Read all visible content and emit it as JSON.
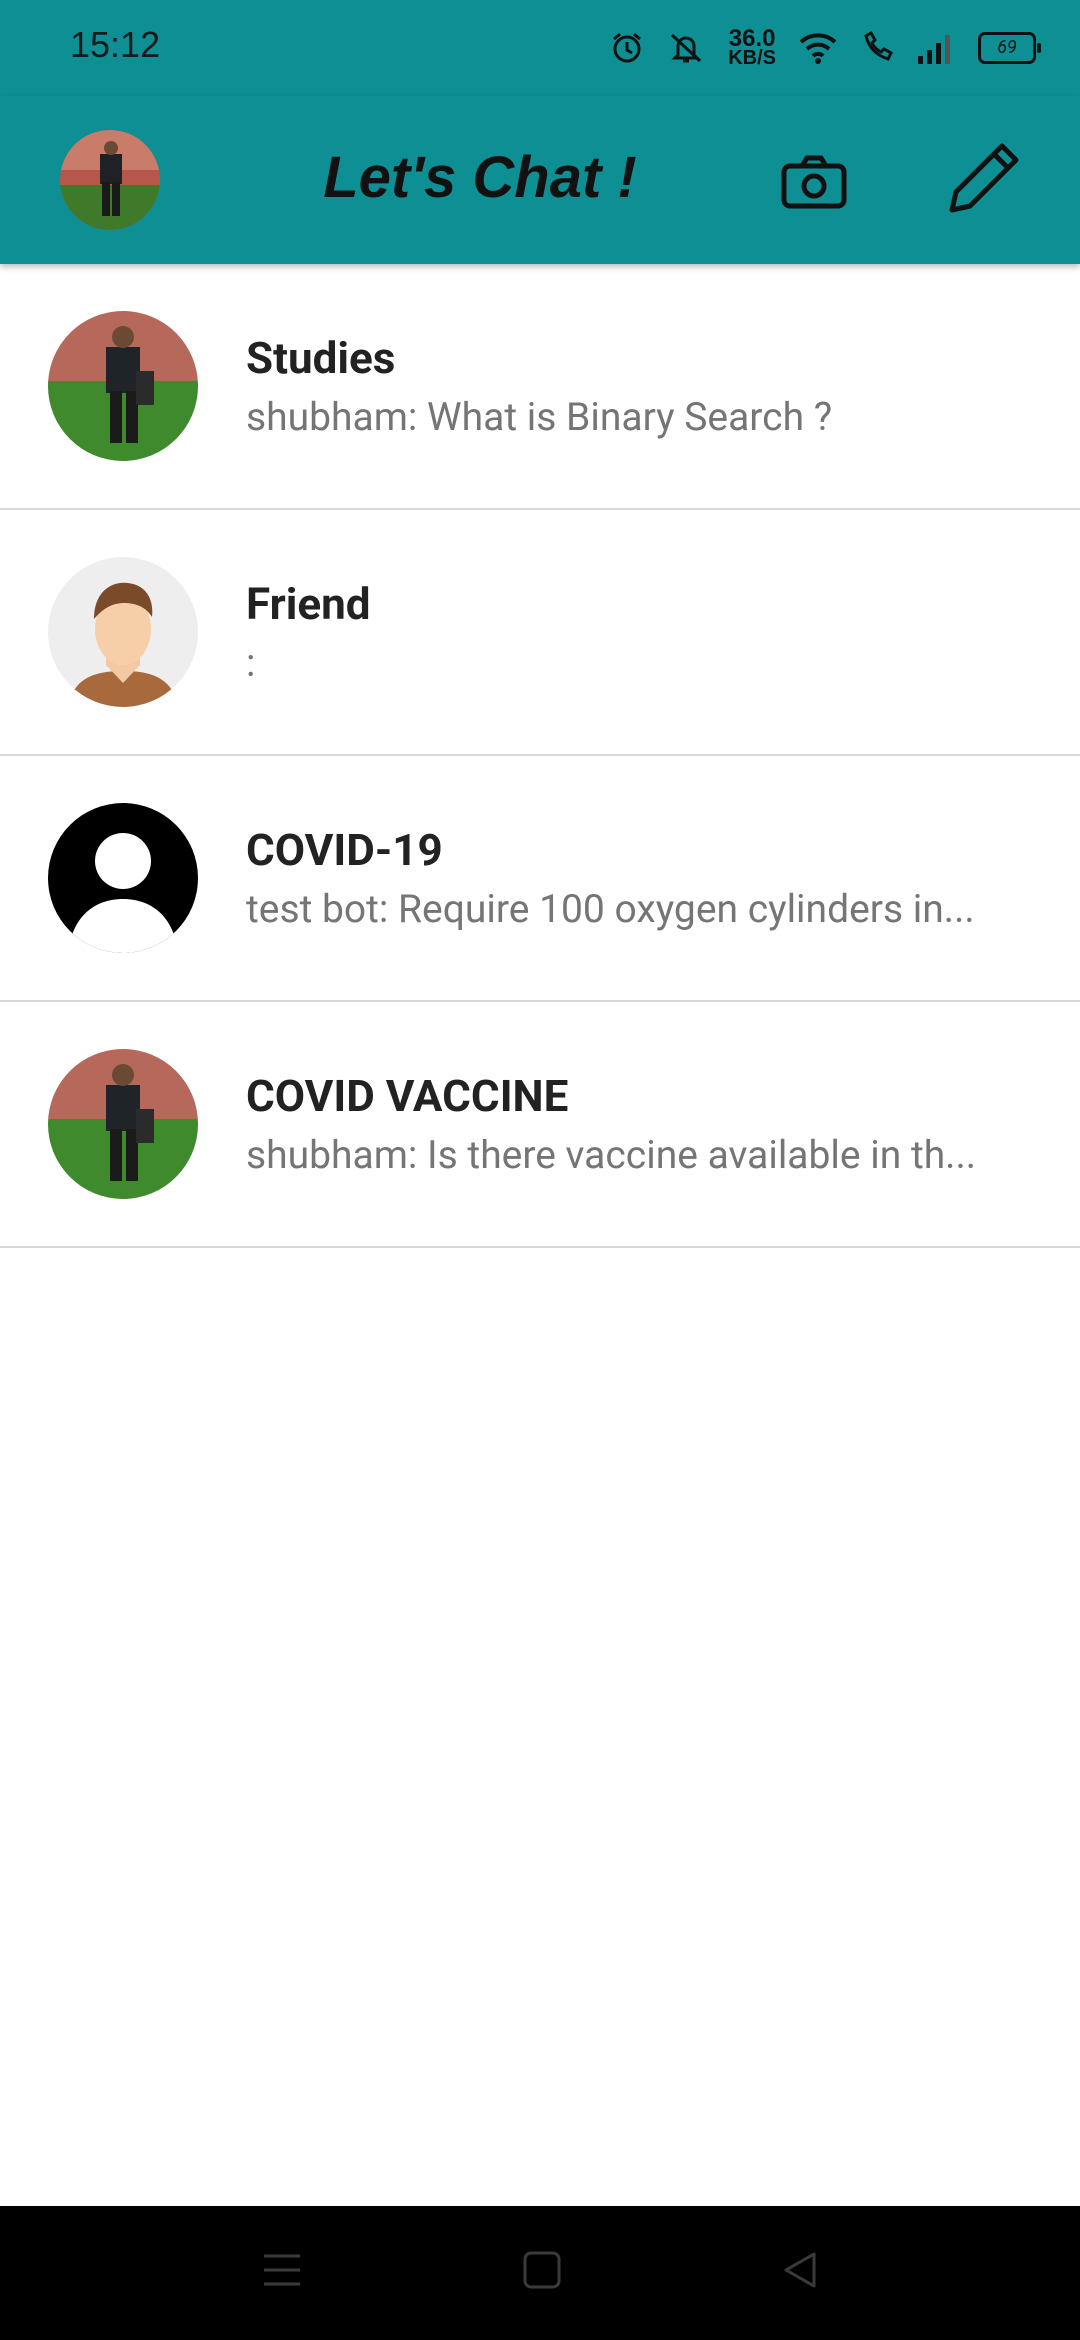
{
  "status_bar": {
    "time": "15:12",
    "net_speed_value": "36.0",
    "net_speed_unit": "KB/S",
    "battery": "69"
  },
  "app_bar": {
    "title": "Let's Chat !",
    "background_color": "#0e8f94"
  },
  "chats": [
    {
      "name": "Studies",
      "last_message": "shubham: What is Binary Search ?",
      "avatar": "photo-person"
    },
    {
      "name": "Friend",
      "last_message": ":",
      "avatar": "cartoon-face"
    },
    {
      "name": "COVID-19",
      "last_message": "test bot: Require 100 oxygen cylinders in...",
      "avatar": "default-silhouette"
    },
    {
      "name": "COVID VACCINE",
      "last_message": "shubham: Is there vaccine available in th...",
      "avatar": "photo-person"
    }
  ],
  "nav_bar": {
    "icons": [
      "menu-icon",
      "home-icon",
      "back-icon"
    ]
  }
}
